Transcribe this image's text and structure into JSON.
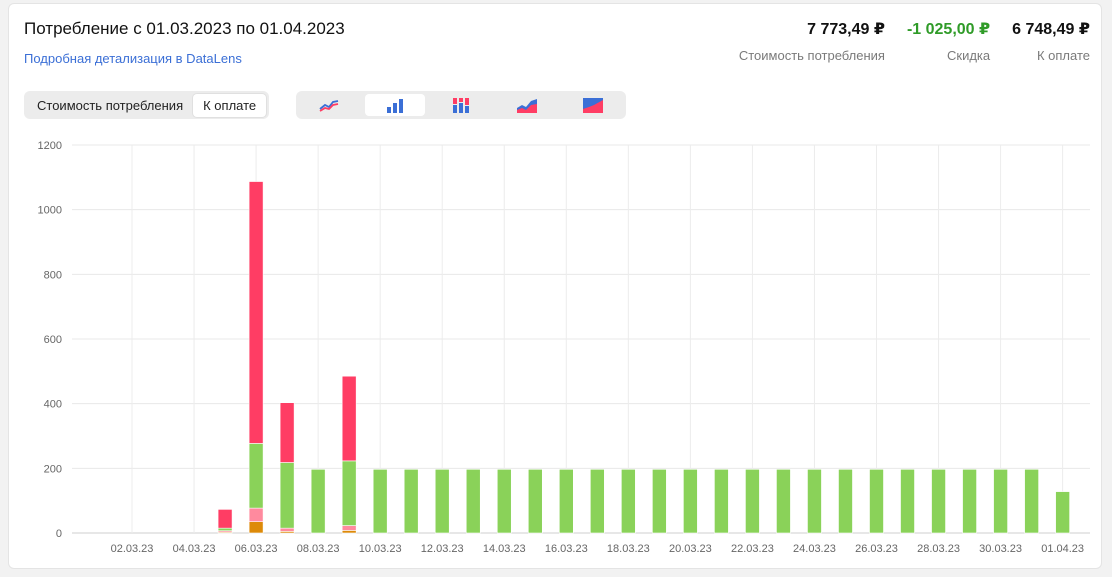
{
  "header": {
    "title": "Потребление с 01.03.2023 по 01.04.2023",
    "datalens_link": "Подробная детализация в DataLens"
  },
  "summary": [
    {
      "value": "7 773,49 ₽",
      "label": "Стоимость потребления"
    },
    {
      "value": "-1 025,00 ₽",
      "label": "Скидка"
    },
    {
      "value": "6 748,49 ₽",
      "label": "К оплате"
    }
  ],
  "mode_switch": {
    "options": [
      "Стоимость потребления",
      "К оплате"
    ],
    "selected": "К оплате"
  },
  "chart_type_switch": {
    "options": [
      "line-chart-icon",
      "bar-chart-icon",
      "stacked-bar-chart-icon",
      "area-chart-icon",
      "stacked-area-chart-icon"
    ],
    "selected": "bar-chart-icon"
  },
  "colors": {
    "green": "#8ad259",
    "red": "#ff3d64",
    "pink": "#ff8a9e",
    "orange": "#dd8a09",
    "link": "#3b6fd6",
    "discount": "#2f9b28"
  },
  "chart_data": {
    "type": "bar",
    "stacked": true,
    "ylim": [
      0,
      1200
    ],
    "yticks": [
      0,
      200,
      400,
      600,
      800,
      1000,
      1200
    ],
    "x": [
      "01.03.23",
      "02.03.23",
      "03.03.23",
      "04.03.23",
      "05.03.23",
      "06.03.23",
      "07.03.23",
      "08.03.23",
      "09.03.23",
      "10.03.23",
      "11.03.23",
      "12.03.23",
      "13.03.23",
      "14.03.23",
      "15.03.23",
      "16.03.23",
      "17.03.23",
      "18.03.23",
      "19.03.23",
      "20.03.23",
      "21.03.23",
      "22.03.23",
      "23.03.23",
      "24.03.23",
      "25.03.23",
      "26.03.23",
      "27.03.23",
      "28.03.23",
      "29.03.23",
      "30.03.23",
      "31.03.23",
      "01.04.23"
    ],
    "xticks": [
      "02.03.23",
      "04.03.23",
      "06.03.23",
      "08.03.23",
      "10.03.23",
      "12.03.23",
      "14.03.23",
      "16.03.23",
      "18.03.23",
      "20.03.23",
      "22.03.23",
      "24.03.23",
      "26.03.23",
      "28.03.23",
      "30.03.23",
      "01.04.23"
    ],
    "series": [
      {
        "color": "#dd8a09",
        "values": [
          0,
          0,
          0,
          0,
          3,
          35,
          5,
          0,
          8,
          0,
          0,
          0,
          0,
          0,
          0,
          0,
          0,
          0,
          0,
          0,
          0,
          0,
          0,
          0,
          0,
          0,
          0,
          0,
          0,
          0,
          0,
          0
        ]
      },
      {
        "color": "#ff8a9e",
        "values": [
          0,
          0,
          0,
          0,
          4,
          42,
          10,
          0,
          15,
          0,
          0,
          0,
          0,
          0,
          0,
          0,
          0,
          0,
          0,
          0,
          0,
          0,
          0,
          0,
          0,
          0,
          0,
          0,
          0,
          0,
          0,
          0
        ]
      },
      {
        "color": "#8ad259",
        "values": [
          0,
          0,
          0,
          0,
          8,
          200,
          203,
          197,
          200,
          197,
          197,
          197,
          197,
          197,
          197,
          197,
          197,
          197,
          197,
          197,
          197,
          197,
          197,
          197,
          197,
          197,
          197,
          197,
          197,
          197,
          197,
          128
        ]
      },
      {
        "color": "#ff3d64",
        "values": [
          0,
          0,
          0,
          0,
          58,
          810,
          185,
          0,
          262,
          0,
          0,
          0,
          0,
          0,
          0,
          0,
          0,
          0,
          0,
          0,
          0,
          0,
          0,
          0,
          0,
          0,
          0,
          0,
          0,
          0,
          0,
          0
        ]
      }
    ]
  }
}
